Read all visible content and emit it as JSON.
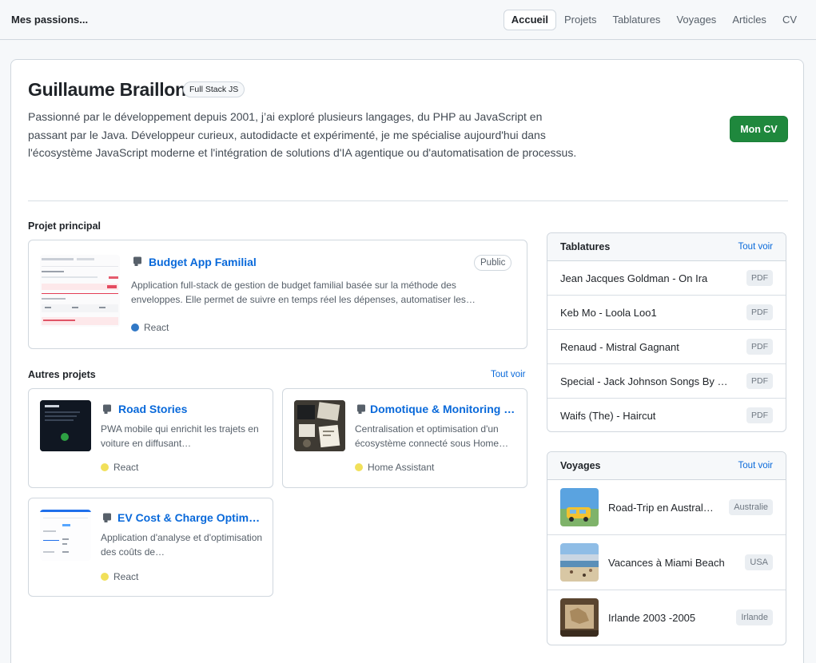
{
  "brand": "Mes passions...",
  "nav": [
    "Accueil",
    "Projets",
    "Tablatures",
    "Voyages",
    "Articles",
    "CV"
  ],
  "hero": {
    "name": "Guillaume Braillon",
    "badge": "Full Stack JS",
    "description": "Passionné par le développement depuis 2001, j’ai exploré plusieurs langages, du PHP au JavaScript en passant par le Java. Développeur curieux, autodidacte et expérimenté, je me spécialise aujourd'hui dans l'écosystème JavaScript moderne et l'intégration de solutions d'IA agentique ou d'automatisation de processus.",
    "cv_button": "Mon CV"
  },
  "main_project": {
    "section_title": "Projet principal",
    "title": "Budget App Familial",
    "visibility": "Public",
    "description": "Application full-stack de gestion de budget familial basée sur la méthode des enveloppes. Elle permet de suivre en temps réel les dépenses, automatiser les…",
    "language": "React",
    "language_color": "#3178c6"
  },
  "other_projects": {
    "section_title": "Autres projets",
    "see_all": "Tout voir",
    "items": [
      {
        "title": "Road Stories",
        "description": "PWA mobile qui enrichit les trajets en voiture en diffusant…",
        "language": "React",
        "language_color": "#f1e05a"
      },
      {
        "title": "Domotique & Monitoring …",
        "description": "Centralisation et optimisation d'un écosystème connecté sous Home…",
        "language": "Home Assistant",
        "language_color": "#f1e05a"
      },
      {
        "title": "EV Cost & Charge Optim…",
        "description": "Application d'analyse et d'optimisation des coûts de…",
        "language": "React",
        "language_color": "#f1e05a"
      }
    ]
  },
  "tablatures": {
    "title": "Tablatures",
    "see_all": "Tout voir",
    "items": [
      {
        "label": "Jean Jacques Goldman - On Ira",
        "tag": "PDF"
      },
      {
        "label": "Keb Mo - Loola Loo1",
        "tag": "PDF"
      },
      {
        "label": "Renaud - Mistral Gagnant",
        "tag": "PDF"
      },
      {
        "label": "Special - Jack Johnson Songs By …",
        "tag": "PDF"
      },
      {
        "label": "Waifs (The) - Haircut",
        "tag": "PDF"
      }
    ]
  },
  "voyages": {
    "title": "Voyages",
    "see_all": "Tout voir",
    "items": [
      {
        "label": "Road-Trip en Austral…",
        "country": "Australie"
      },
      {
        "label": "Vacances à Miami Beach",
        "country": "USA"
      },
      {
        "label": "Irlande 2003 -2005",
        "country": "Irlande"
      }
    ]
  }
}
